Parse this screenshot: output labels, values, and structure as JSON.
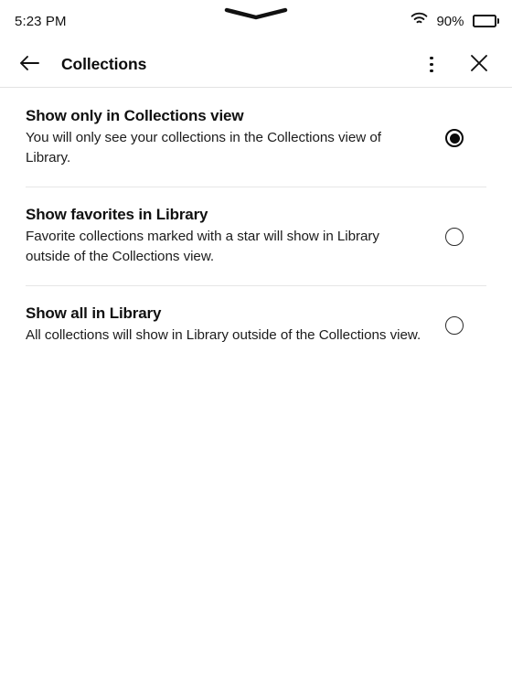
{
  "status_bar": {
    "time": "5:23 PM",
    "wifi_icon": "wifi-icon",
    "battery_percent": "90%",
    "battery_level": 90,
    "battery_icon": "battery-icon",
    "drag_handle_icon": "chevron-down-handle-icon"
  },
  "app_bar": {
    "back_icon": "arrow-left-icon",
    "title": "Collections",
    "overflow_icon": "kebab-menu-icon",
    "close_icon": "close-x-icon"
  },
  "options": {
    "selected_index": 0,
    "items": [
      {
        "title": "Show only in Collections view",
        "description": "You will only see your collections in the Collections view of Library.",
        "selected": true
      },
      {
        "title": "Show favorites in Library",
        "description": "Favorite collections marked with a star will show in Library outside of the Collections view.",
        "selected": false
      },
      {
        "title": "Show all in Library",
        "description": "All collections will show in Library outside of the Collections view.",
        "selected": false
      }
    ]
  },
  "colors": {
    "background": "#ffffff",
    "text_primary": "#101010",
    "text_secondary": "#1c1c1c",
    "divider": "#e6e6e6",
    "appbar_border": "#e3e3e3",
    "accent": "#0a0a0a"
  }
}
